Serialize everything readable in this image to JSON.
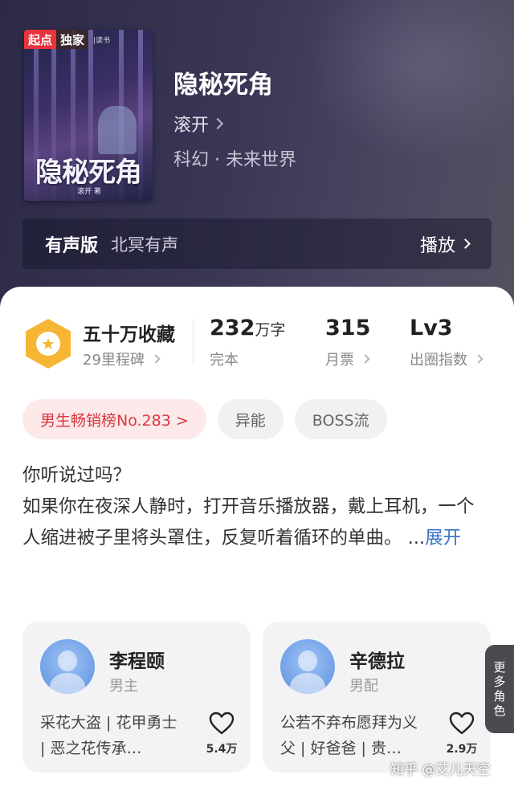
{
  "cover": {
    "badge_red": "起点",
    "badge_dark": "独家",
    "series": "|读书",
    "title": "隐秘死角",
    "author_small": "滚开 著"
  },
  "book": {
    "title": "隐秘死角",
    "author": "滚开",
    "genre": "科幻 · 未来世界"
  },
  "audio": {
    "label": "有声版",
    "studio": "北冥有声",
    "play_label": "播放"
  },
  "stats": {
    "collection": {
      "main": "五十万收藏",
      "sub": "29里程碑"
    },
    "words": {
      "number": "232",
      "unit": "万字",
      "sub": "完本"
    },
    "tickets": {
      "main": "315",
      "sub": "月票"
    },
    "level": {
      "main": "Lv3",
      "sub": "出圈指数"
    }
  },
  "tags": [
    "男生畅销榜No.283 >",
    "异能",
    "BOSS流"
  ],
  "synopsis": {
    "line1": "你听说过吗？",
    "line2": "如果你在夜深人静时，打开音乐播放器，戴上耳机，一个人缩进被子里将头罩住，反复听着循环的单曲。",
    "ellipsis": " ...",
    "expand": "展开"
  },
  "characters": [
    {
      "name": "李程颐",
      "role": "男主",
      "desc": "采花大盗 | 花甲勇士 | 恶之花传承…",
      "likes": "5.4万"
    },
    {
      "name": "辛德拉",
      "role": "男配",
      "desc": "公若不弃布愿拜为义父 | 好爸爸 | 贵…",
      "likes": "2.9万"
    }
  ],
  "more_roles": [
    "更",
    "多",
    "角",
    "色"
  ],
  "watermark": "知乎 @艾儿天空",
  "colors": {
    "hero_bg": "#3a3756",
    "hot_tag": "#d9373f",
    "expand_link": "#3a73c8",
    "medal": "#f6b533"
  }
}
